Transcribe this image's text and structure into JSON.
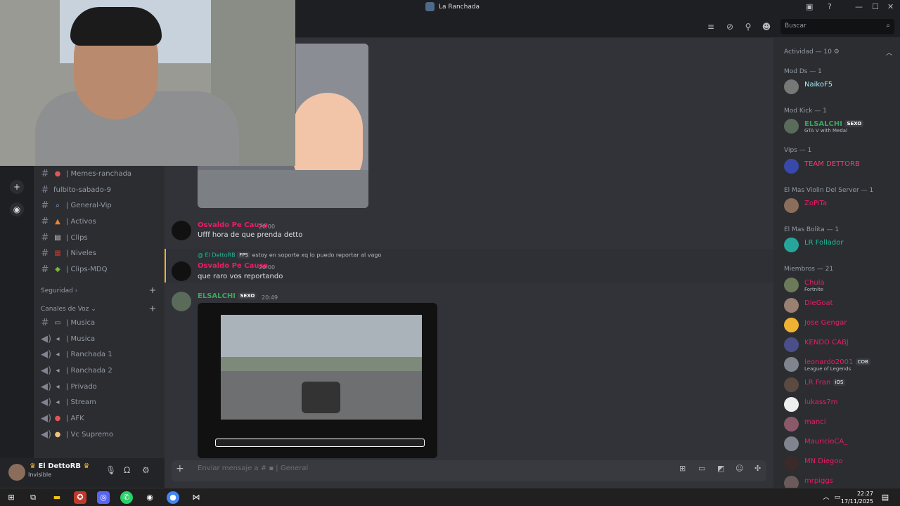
{
  "window": {
    "title": "La Ranchada"
  },
  "search": {
    "placeholder": "Buscar"
  },
  "channels": [
    {
      "icon": "pin-icon",
      "label": "| Memes-ranchada"
    },
    {
      "icon": "",
      "label": "fulbito-sabado-9"
    },
    {
      "icon": "search-icon",
      "label": "| General-Vip"
    },
    {
      "icon": "fire-icon",
      "label": "| Activos"
    },
    {
      "icon": "clapper-icon",
      "label": "| Clips"
    },
    {
      "icon": "bars-icon",
      "label": "| Niveles"
    },
    {
      "icon": "lizard-icon",
      "label": "| Clips-MDQ"
    }
  ],
  "categories": {
    "seguridad": "Seguridad",
    "voz": "Canales de Voz"
  },
  "voice_channels": [
    {
      "label": "| Musica"
    },
    {
      "label": "| Musica"
    },
    {
      "label": "| Ranchada 1"
    },
    {
      "label": "| Ranchada 2"
    },
    {
      "label": "| Privado"
    },
    {
      "label": "| Stream"
    },
    {
      "label": "| AFK"
    },
    {
      "label": "| Vc Supremo"
    }
  ],
  "user": {
    "name": "El DettoRB",
    "status": "Invisible"
  },
  "messages": [
    {
      "author": "Osvaldo Pe Causa",
      "time": "20:00",
      "text": "Ufff hora de que prenda detto"
    },
    {
      "reply_author": "@ El DettoRB",
      "reply_badge": "FPS",
      "reply_text": "estoy en soporte xq lo puedo reportar al vago",
      "author": "Osvaldo Pe Causa",
      "time": "20:00",
      "text": "que raro vos reportando"
    },
    {
      "author": "ELSALCHI",
      "badge": "SEXO",
      "time": "20:49"
    }
  ],
  "composer": {
    "placeholder": "Enviar mensaje a #",
    "channel": "General"
  },
  "members_panel": {
    "groups": [
      {
        "title": "Actividad — 10",
        "members": []
      },
      {
        "title": "Mod Ds — 1",
        "members": [
          {
            "name": "NaikoF5",
            "color": "#a3f0ff",
            "sub": ""
          }
        ]
      },
      {
        "title": "Mod Kick — 1",
        "members": [
          {
            "name": "ELSALCHI",
            "color": "#3ba55c",
            "sub": "GTA V with Medal",
            "badge": "SEXO"
          }
        ]
      },
      {
        "title": "Vips — 1",
        "members": [
          {
            "name": "TEAM DETTORB",
            "color": "#f23f6e",
            "sub": ""
          }
        ]
      },
      {
        "title": "El Mas Violin Del Server — 1",
        "members": [
          {
            "name": "ZoPiTa",
            "color": "#e91e63",
            "sub": ""
          }
        ]
      },
      {
        "title": "El Mas Bolita — 1",
        "members": [
          {
            "name": "LR Follador",
            "color": "#1abc9c",
            "sub": ""
          }
        ]
      },
      {
        "title": "Miembros — 21",
        "members": [
          {
            "name": "Chula",
            "color": "#e91e63",
            "sub": "Fortnite"
          },
          {
            "name": "DieGoat",
            "color": "#e91e63",
            "sub": ""
          },
          {
            "name": "Jose Gengar",
            "color": "#e91e63",
            "sub": ""
          },
          {
            "name": "KENDO CABJ",
            "color": "#e91e63",
            "sub": ""
          },
          {
            "name": "leonardo2001",
            "color": "#e91e63",
            "sub": "League of Legends",
            "badge": "COB"
          },
          {
            "name": "LR Fran",
            "color": "#e91e63",
            "sub": "",
            "badge": "iOS"
          },
          {
            "name": "lukass7m",
            "color": "#e91e63",
            "sub": ""
          },
          {
            "name": "manci",
            "color": "#e91e63",
            "sub": ""
          },
          {
            "name": "MauricioCA_",
            "color": "#e91e63",
            "sub": ""
          },
          {
            "name": "MN Diegoo",
            "color": "#e91e63",
            "sub": ""
          },
          {
            "name": "mrpiggs",
            "color": "#e91e63",
            "sub": ""
          }
        ]
      }
    ]
  },
  "taskbar": {
    "time": "22:27",
    "date": "17/11/2025"
  }
}
